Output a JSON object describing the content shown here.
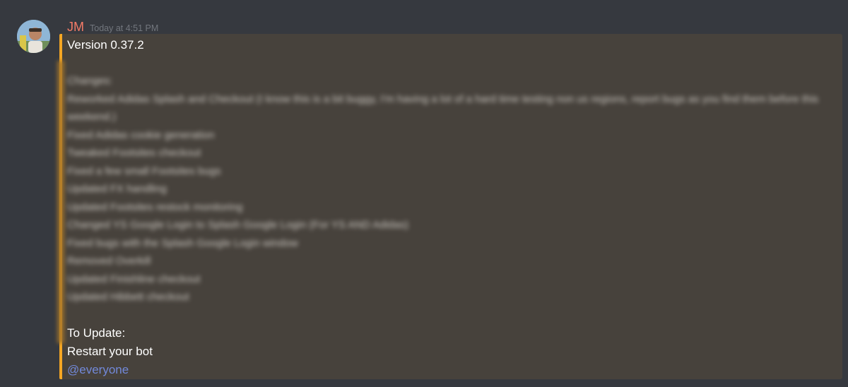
{
  "message": {
    "author": "JM",
    "timestamp": "Today at 4:51 PM",
    "author_color": "#f47b67"
  },
  "embed": {
    "accent_color": "#f5a623",
    "title": "Version 0.37.2",
    "changes_label": "Changes:",
    "changes": [
      "Reworked Adidas Splash and Checkout (I know this is a bit buggy, I'm having a lot of a hard time testing non us regions, report bugs as you find them before this weekend.)",
      "Fixed Adidas cookie generation",
      "Tweaked Footsites checkout",
      "Fixed a few small Footsites bugs",
      "Updated FX handling",
      "Updated Footsites restock monitoring",
      "Changed YS Google Login to Splash Google Login (For YS AND Adidas)",
      "Fixed bugs with the Splash Google Login window",
      "Removed Overkill",
      "Updated Finishline checkout",
      "Updated Hibbett checkout"
    ],
    "update_heading": "To Update:",
    "update_instruction": "Restart your bot",
    "mention": "@everyone"
  }
}
